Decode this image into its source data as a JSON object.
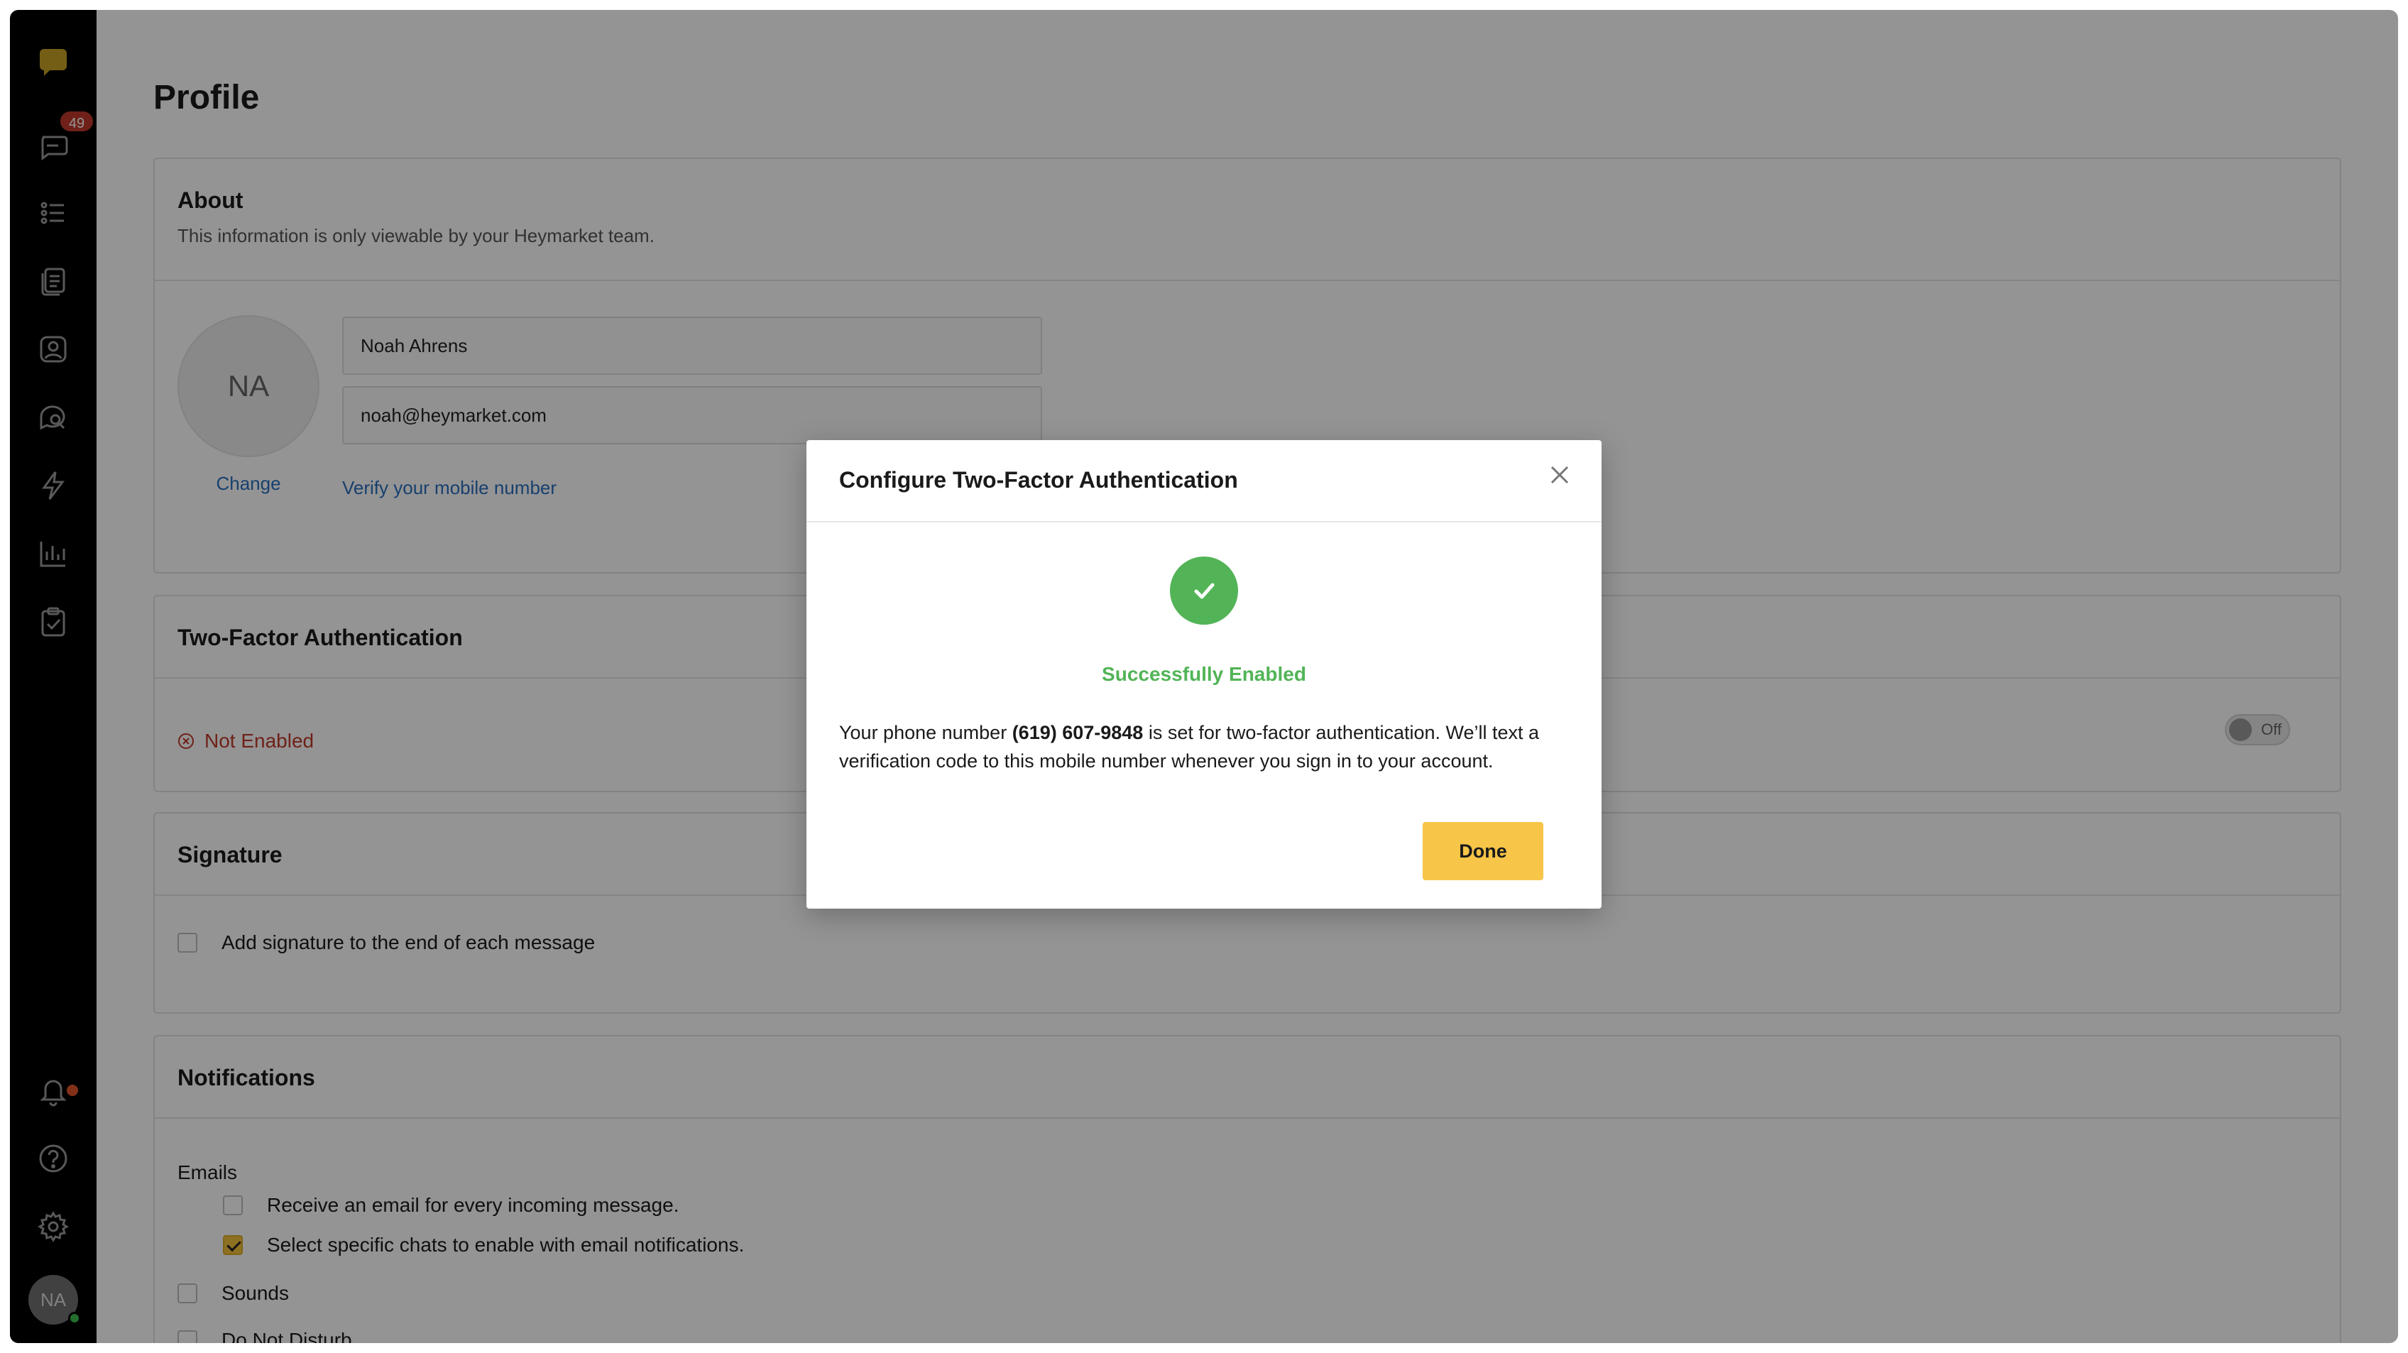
{
  "sidebar": {
    "badge_count": "49",
    "avatar_initials": "NA",
    "icons": [
      "logo-icon",
      "inbox-icon",
      "list-icon",
      "templates-icon",
      "contacts-icon",
      "chat-search-icon",
      "lightning-icon",
      "reports-icon",
      "tasks-icon",
      "bell-icon",
      "help-icon",
      "settings-icon"
    ]
  },
  "page": {
    "title": "Profile"
  },
  "about": {
    "title": "About",
    "subtitle": "This information is only viewable by your Heymarket team.",
    "avatar_initials": "NA",
    "change_label": "Change",
    "name_value": "Noah Ahrens",
    "email_value": "noah@heymarket.com",
    "verify_label": "Verify your mobile number"
  },
  "two_factor": {
    "title": "Two-Factor Authentication",
    "status": "Not Enabled",
    "toggle_label": "Off"
  },
  "signature": {
    "title": "Signature",
    "checkbox_label": "Add signature to the end of each message"
  },
  "notifications": {
    "title": "Notifications",
    "emails_label": "Emails",
    "email_option_1": "Receive an email for every incoming message.",
    "email_option_2": "Select specific chats to enable with email notifications.",
    "sounds_label": "Sounds",
    "dnd_label": "Do Not Disturb"
  },
  "modal": {
    "title": "Configure Two-Factor Authentication",
    "success_text": "Successfully Enabled",
    "body_prefix": "Your phone number ",
    "phone": "(619) 607-9848",
    "body_suffix": " is set for two-factor authentication. We’ll text a verification code to this mobile number whenever you sign in to your account.",
    "done_label": "Done"
  },
  "colors": {
    "accent": "#f7c548",
    "success": "#52b457",
    "error": "#c0392b",
    "link": "#2a6ebd"
  }
}
